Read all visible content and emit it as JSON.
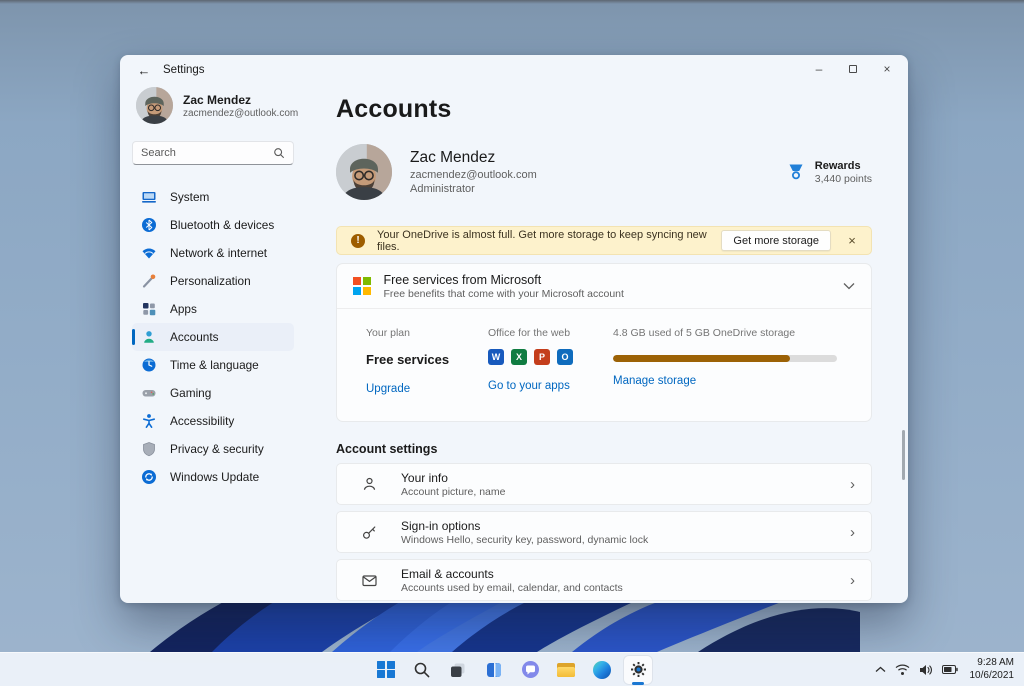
{
  "window": {
    "titlebar": {
      "title": "Settings"
    },
    "sidebar": {
      "user": {
        "name": "Zac Mendez",
        "email": "zacmendez@outlook.com"
      },
      "search": {
        "placeholder": "Search"
      },
      "items": [
        {
          "label": "System"
        },
        {
          "label": "Bluetooth & devices"
        },
        {
          "label": "Network & internet"
        },
        {
          "label": "Personalization"
        },
        {
          "label": "Apps"
        },
        {
          "label": "Accounts",
          "selected": true
        },
        {
          "label": "Time & language"
        },
        {
          "label": "Gaming"
        },
        {
          "label": "Accessibility"
        },
        {
          "label": "Privacy & security"
        },
        {
          "label": "Windows Update"
        }
      ]
    },
    "main": {
      "page_title": "Accounts",
      "profile": {
        "name": "Zac Mendez",
        "email": "zacmendez@outlook.com",
        "role": "Administrator"
      },
      "rewards": {
        "label": "Rewards",
        "points": "3,440 points"
      },
      "banner": {
        "message": "Your OneDrive is almost full. Get more storage to keep syncing new files.",
        "action": "Get more storage"
      },
      "services_card": {
        "title": "Free services from Microsoft",
        "subtitle": "Free benefits that come with your Microsoft account",
        "plan": {
          "caption": "Your plan",
          "value": "Free services",
          "link": "Upgrade"
        },
        "office": {
          "caption": "Office for the web",
          "link": "Go to your apps",
          "apps": [
            {
              "name": "Word",
              "letter": "W",
              "color": "#185abd"
            },
            {
              "name": "Excel",
              "letter": "X",
              "color": "#107c41"
            },
            {
              "name": "PowerPoint",
              "letter": "P",
              "color": "#c43e1c"
            },
            {
              "name": "Outlook",
              "letter": "O",
              "color": "#0f6cbd"
            }
          ]
        },
        "storage": {
          "caption": "4.8 GB used of 5 GB OneDrive storage",
          "link": "Manage storage",
          "percent_used": 79,
          "fill_color": "#9c6206"
        }
      },
      "account_settings": {
        "heading": "Account settings",
        "rows": [
          {
            "title": "Your info",
            "subtitle": "Account picture, name",
            "icon": "person-icon"
          },
          {
            "title": "Sign-in options",
            "subtitle": "Windows Hello, security key, password, dynamic lock",
            "icon": "key-icon"
          },
          {
            "title": "Email & accounts",
            "subtitle": "Accounts used by email, calendar, and contacts",
            "icon": "mail-icon"
          }
        ]
      }
    }
  },
  "taskbar": {
    "clock": {
      "time": "9:28 AM",
      "date": "10/6/2021"
    },
    "icons": [
      "start-icon",
      "search-icon",
      "task-view-icon",
      "widgets-icon",
      "chat-icon",
      "file-explorer-icon",
      "edge-icon",
      "settings-gear-icon"
    ],
    "tray_icons": [
      "chevron-up-icon",
      "wifi-icon",
      "volume-icon",
      "battery-icon"
    ]
  },
  "colors": {
    "accent": "#0067c0",
    "banner_bg": "#fdf2cc",
    "warning": "#9d5d00",
    "storage_fill": "#9c6206",
    "window_bg": "#f2f6fb"
  },
  "icons": {
    "back-icon": "left arrow glyph",
    "search-icon": "magnifier circle+handle",
    "warning-icon": "filled circle with exclamation",
    "microsoft-logo": "2x2 colored squares",
    "rewards-icon": "blue medal ribbon",
    "chevron-down-icon": "expander caret",
    "chevron-right-icon": "row navigate caret"
  }
}
